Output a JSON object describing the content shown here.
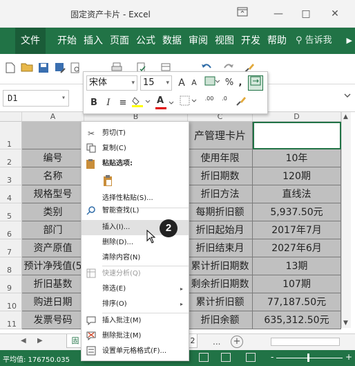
{
  "window": {
    "title": "固定资产卡片 - Excel",
    "ribbon_display_icon": "ribbon-display-icon",
    "minimize": "—",
    "maximize": "□",
    "close": "✕"
  },
  "ribbon": {
    "tabs": [
      "文件",
      "开始",
      "插入",
      "页面",
      "公式",
      "数据",
      "审阅",
      "视图",
      "开发",
      "帮助"
    ],
    "search_placeholder": "告诉我",
    "accent_color": "#217346"
  },
  "quick_access": {
    "icons": [
      "new-file-icon",
      "open-folder-icon",
      "save-icon",
      "save-as-icon",
      "print-preview-icon",
      "print-icon",
      "spelling-icon",
      "copy-format-icon",
      "filter-icon",
      "undo-icon",
      "redo-icon",
      "brush-icon"
    ]
  },
  "formula_bar": {
    "name_box": "D1",
    "dropdown": "▾"
  },
  "grid": {
    "columns": [
      "A",
      "B",
      "C",
      "D"
    ],
    "rows": [
      "1",
      "2",
      "3",
      "4",
      "5",
      "6",
      "7",
      "8",
      "9",
      "10",
      "11"
    ],
    "col_a": [
      "",
      "编号",
      "名称",
      "规格型号",
      "类别",
      "部门",
      "资产原值",
      "预计净残值(5",
      "折旧基数",
      "购进日期",
      "发票号码"
    ],
    "col_c": [
      "产管理卡片",
      "使用年限",
      "折旧期数",
      "折旧方法",
      "每期折旧额",
      "折旧起始月",
      "折旧结束月",
      "累计折旧期数",
      "剩余折旧期数",
      "累计折旧额",
      "折旧余额"
    ],
    "col_d": [
      "",
      "10年",
      "120期",
      "直线法",
      "5,937.50元",
      "2017年7月",
      "2027年6月",
      "13期",
      "107期",
      "77,187.50元",
      "635,312.50元"
    ]
  },
  "mini_toolbar": {
    "font_name": "宋体",
    "font_size": "15",
    "grow_font": "A",
    "shrink_font": "A",
    "percent": "%",
    "comma": ",",
    "bold": "B",
    "italic": "I",
    "align": "≡",
    "font_color_letter": "A",
    "decimal_increase": ".00",
    "decimal_decrease": ".0"
  },
  "context_menu": {
    "cut": "剪切(T)",
    "copy": "复制(C)",
    "paste_options": "粘贴选项:",
    "paste_special": "选择性粘贴(S)...",
    "smart_lookup": "智能查找(L)",
    "insert": "插入(I)...",
    "delete": "删除(D)...",
    "clear": "清除内容(N)",
    "quick_analysis": "快速分析(Q)",
    "filter": "筛选(E)",
    "sort": "排序(O)",
    "insert_comment": "插入批注(M)",
    "delete_comment": "删除批注(M)",
    "format_cells": "设置单元格格式(F)...",
    "submenu_arrow": "▸"
  },
  "annotation": {
    "step_number": "2"
  },
  "sheet_bar": {
    "sheet_partial": "固",
    "sheet_partial_2": "2",
    "more": "...",
    "add": "+"
  },
  "status_bar": {
    "average": "平均值: 176750.035",
    "zoom_minus": "-",
    "zoom_plus": "+"
  }
}
